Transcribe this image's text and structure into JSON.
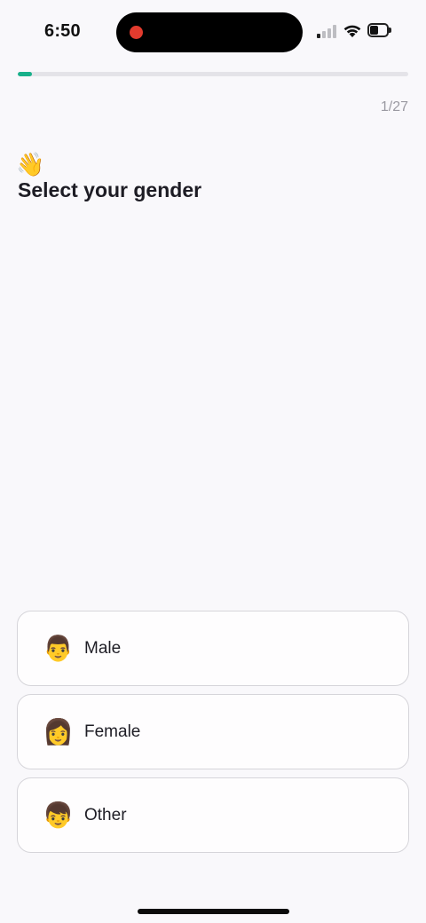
{
  "status_bar": {
    "time": "6:50",
    "battery_level": 0.4
  },
  "progress": {
    "fraction": 0.037,
    "step_label": "1/27"
  },
  "header": {
    "emoji": "👋",
    "title": "Select your gender"
  },
  "options": [
    {
      "emoji": "👨",
      "label": "Male"
    },
    {
      "emoji": "👩",
      "label": "Female"
    },
    {
      "emoji": "👦",
      "label": "Other"
    }
  ],
  "colors": {
    "accent": "#18b08a",
    "background": "#f9f8fb",
    "card_border": "#d6d5da"
  }
}
